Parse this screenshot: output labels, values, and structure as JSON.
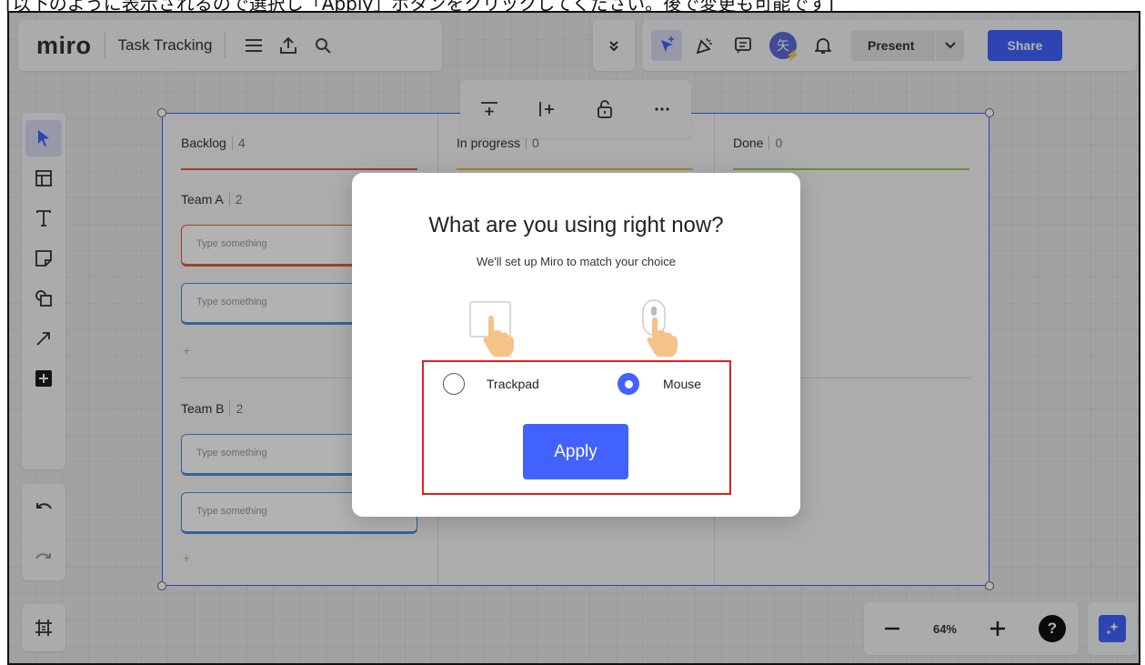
{
  "caption": {
    "text": "[以下のように表示されるので選択し「Apply」ボタンをクリックしてください。後で変更も可能です]"
  },
  "header": {
    "logo": "miro",
    "board_name": "Task Tracking",
    "present_label": "Present",
    "share_label": "Share",
    "avatar_text": "矢"
  },
  "kanban": {
    "columns": [
      {
        "title": "Backlog",
        "count": "4",
        "color": "#e55e3a"
      },
      {
        "title": "In progress",
        "count": "0",
        "color": "#f4b942"
      },
      {
        "title": "Done",
        "count": "0",
        "color": "#8fd14f"
      }
    ],
    "groups": [
      {
        "title": "Team A",
        "count": "2"
      },
      {
        "title": "Team B",
        "count": "2"
      }
    ],
    "card_placeholder": "Type something",
    "add_symbol": "+"
  },
  "modal": {
    "title": "What are you using right now?",
    "subtitle": "We'll set up Miro to match your choice",
    "options": [
      {
        "label": "Trackpad",
        "selected": false
      },
      {
        "label": "Mouse",
        "selected": true
      }
    ],
    "apply_label": "Apply"
  },
  "zoom": {
    "level": "64%",
    "help": "?"
  },
  "colors": {
    "accent": "#4262ff",
    "highlight": "#e02020"
  }
}
